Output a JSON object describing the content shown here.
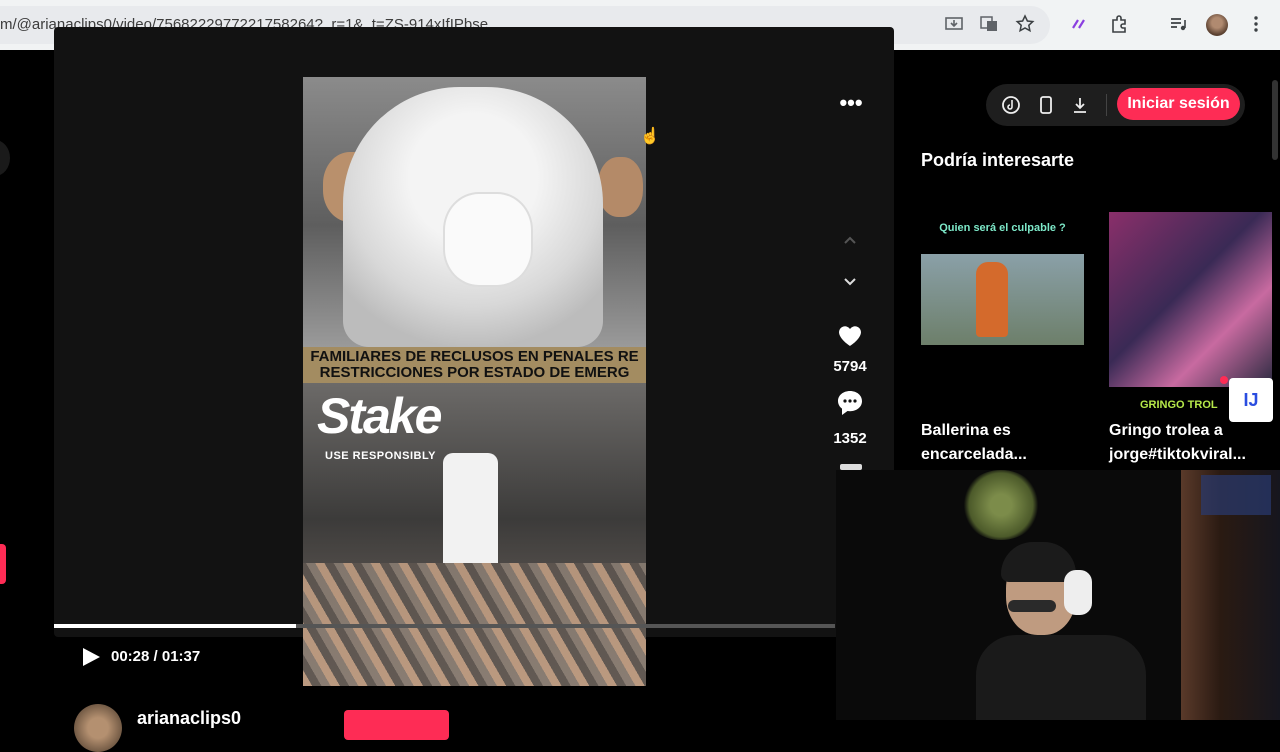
{
  "browser": {
    "url": "m/@arianaclips0/video/7568222977221758264?_r=1&_t=ZS-914xIfIPbse",
    "icons": [
      "install-icon",
      "translate-icon",
      "bookmark-star-icon",
      "extension-purple-icon",
      "puzzle-extensions-icon",
      "media-queue-icon",
      "profile-avatar",
      "menu-dots-icon"
    ]
  },
  "video": {
    "banner_line1": "FAMILIARES DE RECLUSOS EN PENALES RE",
    "banner_line2": "RESTRICCIONES POR ESTADO DE EMERG",
    "stake_logo": "Stake",
    "stake_sub": "USE RESPONSIBLY",
    "progress_fraction": 0.31,
    "time": "00:28 / 01:37"
  },
  "actions": {
    "more": "•••",
    "likes": "5794",
    "comments": "1352"
  },
  "author": {
    "name": "arianaclips0"
  },
  "toolbar": {
    "login_label": "Iniciar sesión",
    "icons": [
      "tiktok-coin-icon",
      "mobile-icon",
      "download-icon"
    ]
  },
  "recommendations": {
    "title": "Podría interesarte",
    "items": [
      {
        "caption": "Quien será el culpable ?",
        "label": "Ballerina es encarcelada..."
      },
      {
        "caption": "GRINGO TROL",
        "label": "Gringo trolea a jorge#tiktokviral..."
      }
    ],
    "badge": "IJ"
  },
  "colors": {
    "accent": "#fe2c55",
    "background": "#000000",
    "panel": "#121212"
  }
}
